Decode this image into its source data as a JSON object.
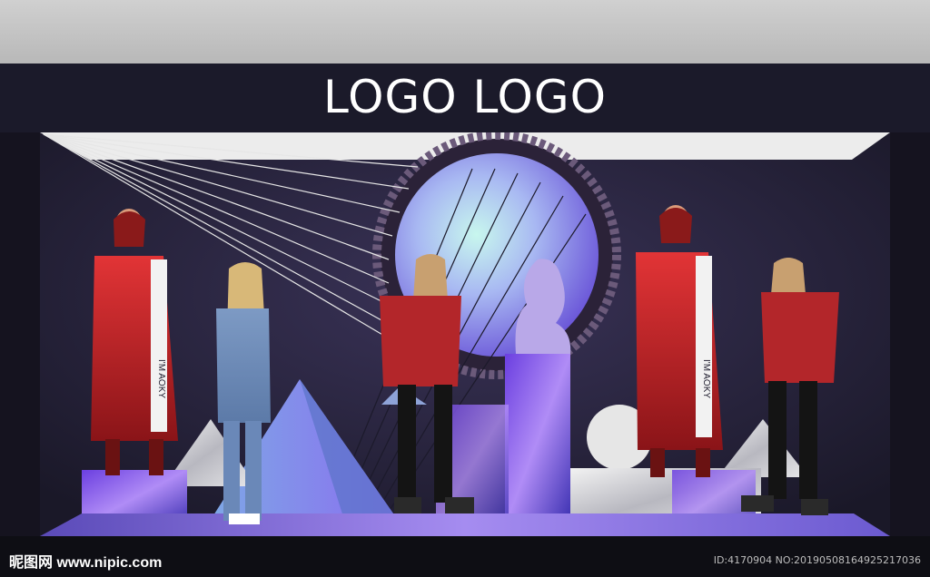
{
  "header": {
    "logo_text": "LOGO LOGO"
  },
  "mannequins": {
    "m1_label": "I'M AOKY",
    "m4_label": "I'M AOKY"
  },
  "watermark": {
    "site": "昵图网 www.nipic.com",
    "id_text": "ID:4170904 NO:20190508164925217036"
  },
  "colors": {
    "header_bg": "#1b1a2a",
    "ceiling": "#cfcfcf",
    "accent_purple": "#8a6cf0",
    "accent_red": "#c9262a"
  }
}
